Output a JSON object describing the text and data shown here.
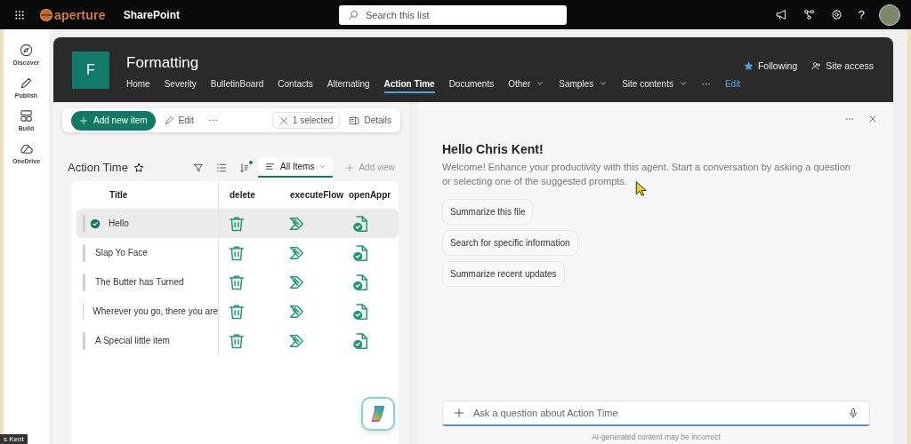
{
  "top_bar": {
    "brand": "aperture",
    "app": "SharePoint",
    "search": {
      "placeholder": "Search this list"
    },
    "help": "?"
  },
  "rail": [
    {
      "label": "Discover",
      "kind": "compass"
    },
    {
      "label": "Publish",
      "kind": "pen"
    },
    {
      "label": "Build",
      "kind": "blocks"
    },
    {
      "label": "OneDrive",
      "kind": "cloud"
    }
  ],
  "site": {
    "logo_letter": "F",
    "title": "Formatting",
    "nav": [
      {
        "label": "Home",
        "kind": "link",
        "selected": false
      },
      {
        "label": "Severity",
        "kind": "link",
        "selected": false
      },
      {
        "label": "BulletinBoard",
        "kind": "link",
        "selected": false
      },
      {
        "label": "Contacts",
        "kind": "link",
        "selected": false
      },
      {
        "label": "Alternating",
        "kind": "link",
        "selected": false
      },
      {
        "label": "Action Time",
        "kind": "link",
        "selected": true
      },
      {
        "label": "Documents",
        "kind": "link",
        "selected": false
      },
      {
        "label": "Other",
        "kind": "menu",
        "selected": false
      },
      {
        "label": "Samples",
        "kind": "menu",
        "selected": false
      },
      {
        "label": "Site contents",
        "kind": "menu",
        "selected": false
      },
      {
        "label": "···",
        "kind": "more",
        "selected": false
      },
      {
        "label": "Edit",
        "kind": "edit",
        "selected": false
      }
    ],
    "following": "Following",
    "site_access": "Site access"
  },
  "command_bar": {
    "add": "Add new item",
    "edit": "Edit",
    "selection": "1 selected",
    "details": "Details"
  },
  "list": {
    "title": "Action Time",
    "view": "All Items",
    "add_view": "Add view",
    "columns": [
      "Title",
      "delete",
      "executeFlow",
      "openAppr"
    ],
    "rows": [
      {
        "title": "Hello",
        "selected": true
      },
      {
        "title": "Slap Yo Face",
        "selected": false
      },
      {
        "title": "The Butter has Turned",
        "selected": false
      },
      {
        "title": "Wherever you go, there you are",
        "selected": false
      },
      {
        "title": "A Special little item",
        "selected": false
      }
    ]
  },
  "copilot": {
    "greeting": "Hello Chris Kent!",
    "intro": "Welcome! Enhance your productivity with this agent. Start a conversation by asking a question or selecting one of the suggested prompts.",
    "prompts": [
      "Summarize this file",
      "Search for specific information",
      "Summarize recent updates"
    ],
    "input": {
      "placeholder": "Ask a question about Action Time"
    },
    "disclaimer": "AI-generated content may be incorrect"
  },
  "video_overlay": {
    "name": "s Kent"
  }
}
